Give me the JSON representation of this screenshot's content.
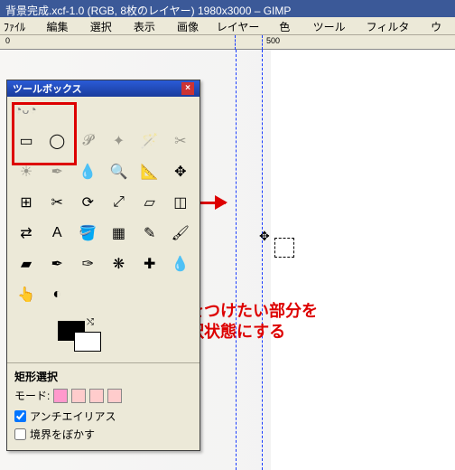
{
  "title": "背景完成.xcf-1.0 (RGB, 8枚のレイヤー) 1980x3000 – GIMP",
  "menu": {
    "file": "ﾌｧｲﾙ(F)",
    "edit": "編集(E)",
    "select": "選択(S)",
    "view": "表示(V)",
    "image": "画像(I)",
    "layer": "レイヤー(L)",
    "colors": "色(C)",
    "tools": "ツール(T)",
    "filters": "フィルタ(R)",
    "window": "ウィ"
  },
  "ruler": {
    "mark0": "0",
    "mark500": "500"
  },
  "toolbox": {
    "title": "ツールボックス",
    "opts_title": "矩形選択",
    "mode_label": "モード:",
    "antialias": "アンチエイリアス",
    "feather": "境界をぼかす"
  },
  "annotation": {
    "line1": "影をつけたい部分を",
    "line2": "選択状態にする"
  },
  "tools": [
    {
      "name": "rect-select",
      "glyph": "▭"
    },
    {
      "name": "ellipse-select",
      "glyph": "◯"
    },
    {
      "name": "free-select",
      "glyph": "𝓟"
    },
    {
      "name": "fuzzy-select",
      "glyph": "✦"
    },
    {
      "name": "color-select",
      "glyph": "🪄"
    },
    {
      "name": "scissors",
      "glyph": "✂"
    },
    {
      "name": "foreground",
      "glyph": "☀"
    },
    {
      "name": "paths",
      "glyph": "✒"
    },
    {
      "name": "color-picker",
      "glyph": "💧"
    },
    {
      "name": "zoom",
      "glyph": "🔍"
    },
    {
      "name": "measure",
      "glyph": "📐"
    },
    {
      "name": "move",
      "glyph": "✥"
    },
    {
      "name": "align",
      "glyph": "⊞"
    },
    {
      "name": "crop",
      "glyph": "✂"
    },
    {
      "name": "rotate",
      "glyph": "⟳"
    },
    {
      "name": "scale",
      "glyph": "⤢"
    },
    {
      "name": "shear",
      "glyph": "▱"
    },
    {
      "name": "perspective",
      "glyph": "◫"
    },
    {
      "name": "flip",
      "glyph": "⇄"
    },
    {
      "name": "text",
      "glyph": "A"
    },
    {
      "name": "bucket",
      "glyph": "🪣"
    },
    {
      "name": "gradient",
      "glyph": "▦"
    },
    {
      "name": "pencil",
      "glyph": "✎"
    },
    {
      "name": "paintbrush",
      "glyph": "🖌"
    },
    {
      "name": "eraser",
      "glyph": "▰"
    },
    {
      "name": "airbrush",
      "glyph": "✒"
    },
    {
      "name": "ink",
      "glyph": "✑"
    },
    {
      "name": "clone",
      "glyph": "❋"
    },
    {
      "name": "heal",
      "glyph": "✚"
    },
    {
      "name": "blur",
      "glyph": "💧"
    },
    {
      "name": "smudge",
      "glyph": "👆"
    },
    {
      "name": "dodge",
      "glyph": "◐"
    }
  ]
}
